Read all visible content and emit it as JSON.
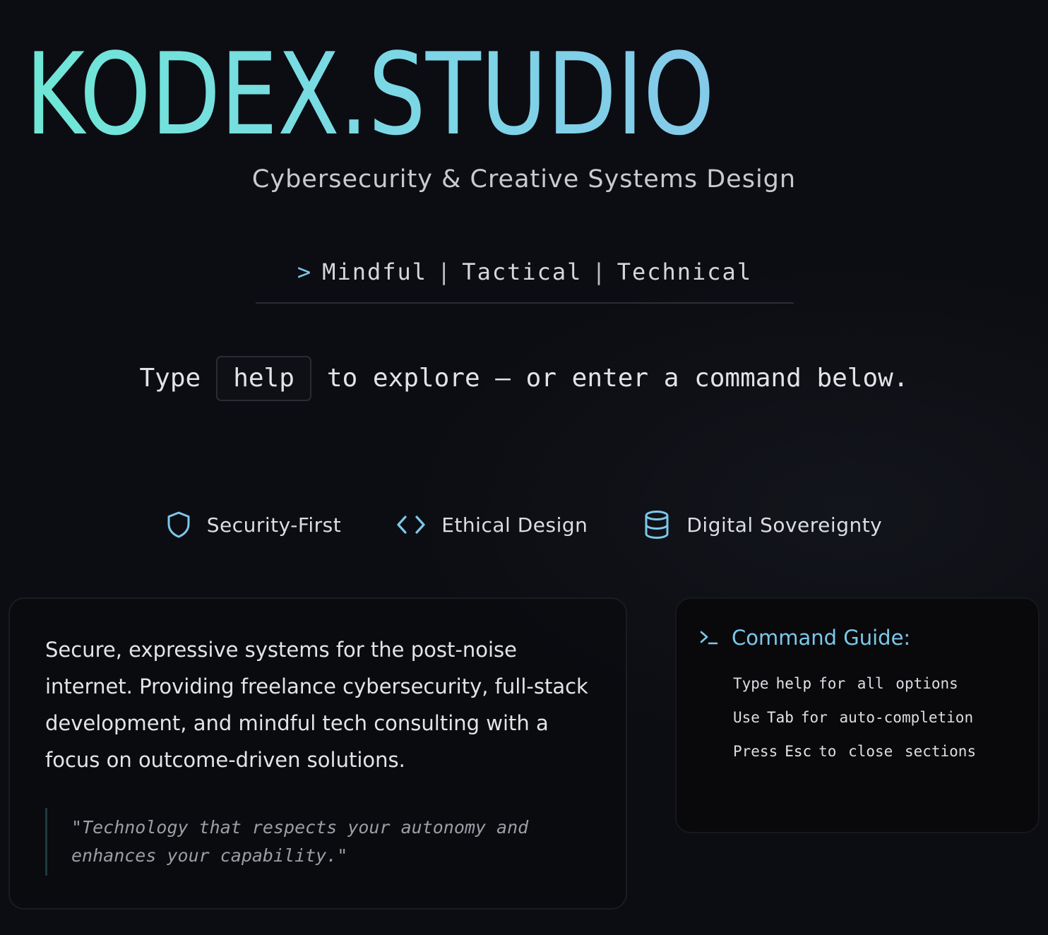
{
  "hero": {
    "title": "KODEX.STUDIO_",
    "subtitle": "Cybersecurity & Creative Systems Design"
  },
  "tagline": {
    "prompt": ">",
    "items": [
      "Mindful",
      "Tactical",
      "Technical"
    ],
    "separator": "|"
  },
  "command_line": {
    "before": "Type",
    "key": "help",
    "after": "to explore — or enter a command below."
  },
  "features": [
    {
      "icon": "shield-icon",
      "label": "Security-First"
    },
    {
      "icon": "code-icon",
      "label": "Ethical Design"
    },
    {
      "icon": "database-icon",
      "label": "Digital Sovereignty"
    }
  ],
  "about": {
    "text": "Secure, expressive systems for the post-noise internet. Providing freelance cybersecurity, full-stack development, and mindful tech consulting with a focus on outcome-driven solutions.",
    "quote": "\"Technology that respects your autonomy and enhances your capability.\""
  },
  "guide": {
    "icon": "terminal-icon",
    "title": "Command Guide:",
    "items": [
      {
        "before": "Type",
        "key": "help",
        "after": "for all options"
      },
      {
        "before": "Use",
        "key": "Tab",
        "after": "for auto-completion"
      },
      {
        "before": "Press",
        "key": "Esc",
        "after": "to close sections"
      }
    ]
  },
  "colors": {
    "accent": "#7cc8ea",
    "title_gradient_start": "#6fe7d6",
    "title_gradient_end": "#86c7ea",
    "background": "#0c0d12"
  }
}
